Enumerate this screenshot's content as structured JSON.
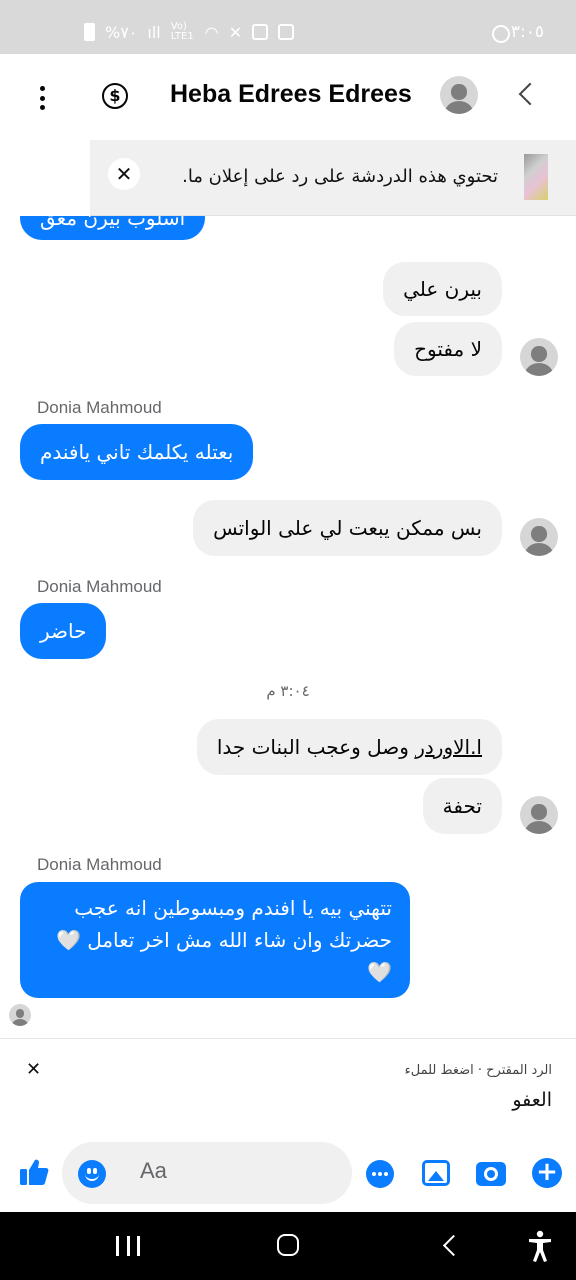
{
  "status_bar": {
    "time": "٣:٠٥",
    "battery": "%٧٠",
    "network": "Vo) LTE1"
  },
  "header": {
    "title": "Heba Edrees Edrees"
  },
  "ad_banner": {
    "text": "تحتوي هذه الدردشة على رد على إعلان ما."
  },
  "messages": {
    "m0": "اسلوب بيرن معق",
    "m1": "بيرن علي",
    "m2": "لا مفتوح",
    "sender1": "Donia Mahmoud",
    "m3": "بعتله يكلمك تاني يافندم",
    "m4": "بس ممكن يبعت لي على الواتس",
    "sender2": "Donia Mahmoud",
    "m5": "حاضر",
    "timestamp": "٣:٠٤ م",
    "m6_link": "ا.الاوردر",
    "m6_rest": " وصل وعجب البنات جدا",
    "m7": "تحفة",
    "sender3": "Donia Mahmoud",
    "m8_line1": "تتهني بيه يا افندم ومبسوطين انه عجب",
    "m8_line2": "حضرتك وان شاء الله مش اخر تعامل 🤍",
    "m8_line3": "🤍"
  },
  "suggested_reply": {
    "label": "الرد المقترح · اضغط للملء",
    "text": "العفو"
  },
  "composer": {
    "placeholder": "Aa"
  },
  "colors": {
    "accent": "#0a7cff",
    "incoming_bubble": "#f0f0f0",
    "status_bar": "#d9d9d9"
  }
}
